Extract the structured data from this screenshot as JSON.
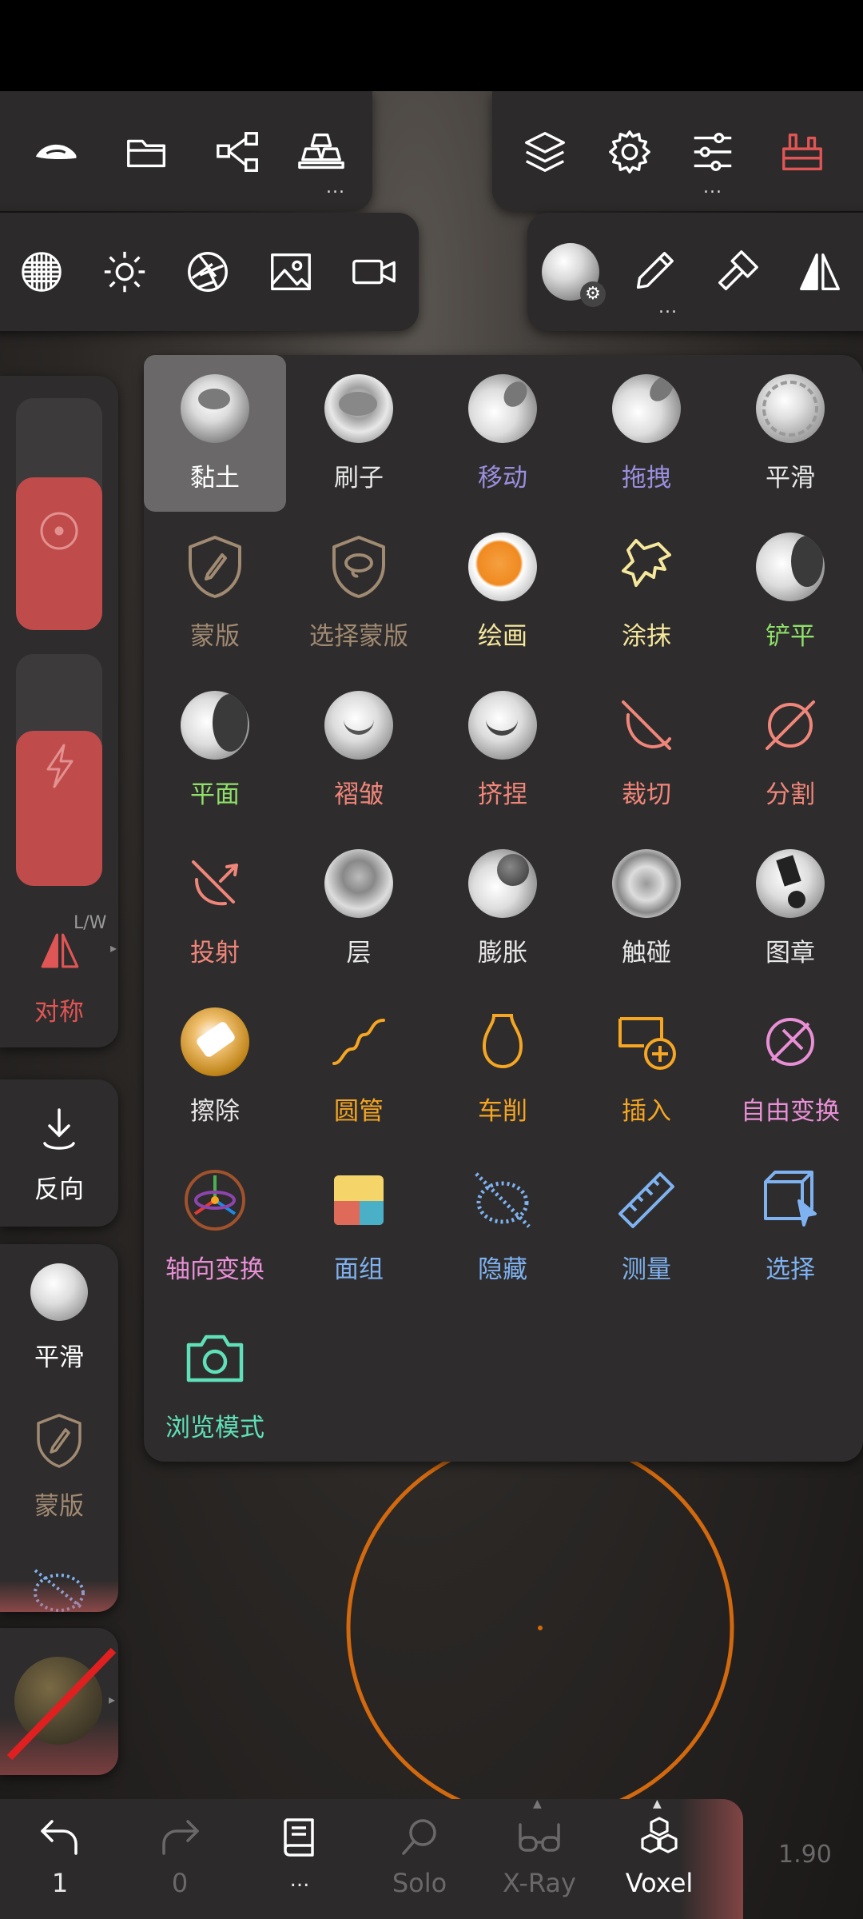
{
  "top_toolbar_left": {
    "icons": [
      "hat-icon",
      "folder-icon",
      "share-icon",
      "gold-bars-icon"
    ],
    "more": "..."
  },
  "top_toolbar_right": {
    "icons": [
      "layers-icon",
      "gear-icon",
      "sliders-icon",
      "toolbox-icon"
    ],
    "more": "..."
  },
  "second_toolbar_left": {
    "icons": [
      "sphere-grid-icon",
      "sun-icon",
      "aperture-icon",
      "image-icon",
      "video-camera-icon"
    ]
  },
  "second_toolbar_right": {
    "icons": [
      "material-sphere-icon",
      "brush-icon",
      "paint-tool-icon",
      "mirror-triangle-icon"
    ],
    "more": "..."
  },
  "tools": [
    {
      "label": "黏土",
      "color": "#ffffff",
      "icon": "clay-sphere-icon",
      "selected": true
    },
    {
      "label": "刷子",
      "color": "#e8e8e8",
      "icon": "brush-sphere-icon"
    },
    {
      "label": "移动",
      "color": "#9b8fe0",
      "icon": "move-sphere-icon"
    },
    {
      "label": "拖拽",
      "color": "#9b8fe0",
      "icon": "drag-sphere-icon"
    },
    {
      "label": "平滑",
      "color": "#e8e8e8",
      "icon": "smooth-sphere-icon"
    },
    {
      "label": "蒙版",
      "color": "#a08a72",
      "icon": "mask-shield-icon"
    },
    {
      "label": "选择蒙版",
      "color": "#a08a72",
      "icon": "select-mask-shield-icon"
    },
    {
      "label": "绘画",
      "color": "#f5e79c",
      "icon": "paint-sphere-icon"
    },
    {
      "label": "涂抹",
      "color": "#f5e79c",
      "icon": "smudge-hand-icon"
    },
    {
      "label": "铲平",
      "color": "#8fe06a",
      "icon": "flatten-sphere-icon"
    },
    {
      "label": "平面",
      "color": "#8fe06a",
      "icon": "plane-sphere-icon"
    },
    {
      "label": "褶皱",
      "color": "#f0867a",
      "icon": "crease-sphere-icon"
    },
    {
      "label": "挤捏",
      "color": "#f0867a",
      "icon": "pinch-sphere-icon"
    },
    {
      "label": "裁切",
      "color": "#f0867a",
      "icon": "trim-icon"
    },
    {
      "label": "分割",
      "color": "#f0867a",
      "icon": "split-icon"
    },
    {
      "label": "投射",
      "color": "#f0867a",
      "icon": "project-icon"
    },
    {
      "label": "层",
      "color": "#e8e8e8",
      "icon": "layer-sphere-icon"
    },
    {
      "label": "膨胀",
      "color": "#e8e8e8",
      "icon": "inflate-sphere-icon"
    },
    {
      "label": "触碰",
      "color": "#e8e8e8",
      "icon": "tube-sphere-icon"
    },
    {
      "label": "图章",
      "color": "#e8e8e8",
      "icon": "stamp-sphere-icon"
    },
    {
      "label": "擦除",
      "color": "#e8e8e8",
      "icon": "erase-sphere-icon"
    },
    {
      "label": "圆管",
      "color": "#f5a623",
      "icon": "tube-curve-icon"
    },
    {
      "label": "车削",
      "color": "#f5a623",
      "icon": "lathe-vase-icon"
    },
    {
      "label": "插入",
      "color": "#f5a623",
      "icon": "insert-icon"
    },
    {
      "label": "自由变换",
      "color": "#e88fd6",
      "icon": "free-transform-icon"
    },
    {
      "label": "轴向变换",
      "color": "#e88fd6",
      "icon": "gizmo-icon"
    },
    {
      "label": "面组",
      "color": "#7fb2f0",
      "icon": "face-group-icon"
    },
    {
      "label": "隐藏",
      "color": "#7fb2f0",
      "icon": "hide-icon"
    },
    {
      "label": "测量",
      "color": "#7fb2f0",
      "icon": "ruler-icon"
    },
    {
      "label": "选择",
      "color": "#7fb2f0",
      "icon": "select-cube-icon"
    },
    {
      "label": "浏览模式",
      "color": "#5fe0b8",
      "icon": "camera-icon"
    }
  ],
  "left_panel": {
    "radius_value": 0.66,
    "intensity_value": 0.67,
    "symmetry_label": "对称",
    "symmetry_hint": "L/W",
    "reverse_label": "反向",
    "smooth_label": "平滑",
    "mask_label": "蒙版"
  },
  "bottom_bar": {
    "undo_count": "1",
    "redo_count": "0",
    "history_label": "...",
    "solo_label": "Solo",
    "xray_label": "X-Ray",
    "voxel_label": "Voxel"
  },
  "version": "1.90",
  "colors": {
    "accent_red": "#c04b4b",
    "brush_ring": "#d2690e",
    "panel": "#2e2c2c",
    "selected": "#6a6868",
    "green_side": "#3f8f4a"
  }
}
